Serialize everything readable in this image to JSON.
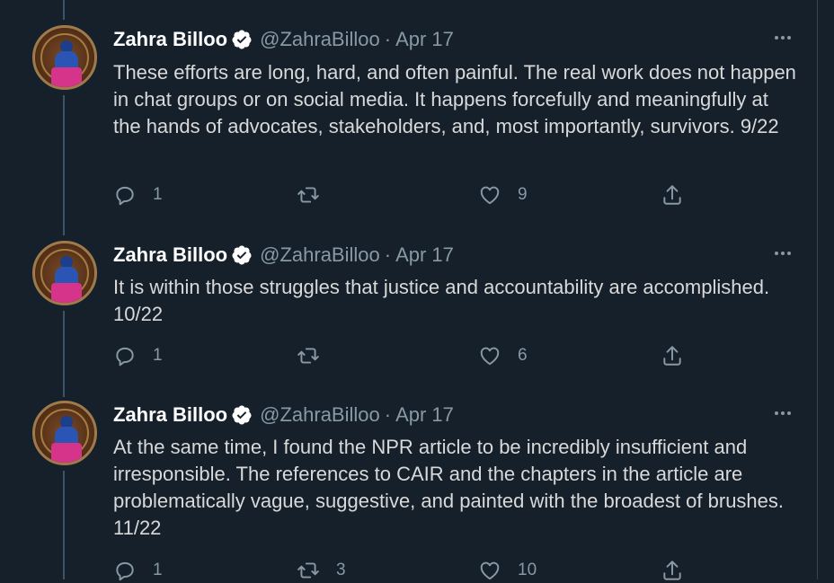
{
  "author": {
    "name": "Zahra Billoo",
    "handle": "@ZahraBilloo",
    "separator": "·"
  },
  "tweets": [
    {
      "date": "Apr 17",
      "text": "These efforts are long, hard, and often painful. The real work does not happen in chat groups or on social media. It happens forcefully and meaningfully at the hands of advocates, stakeholders, and, most importantly, survivors. 9/22",
      "replies": "1",
      "retweets": "",
      "likes": "9"
    },
    {
      "date": "Apr 17",
      "text": "It is within those struggles that justice and accountability are accomplished. 10/22",
      "replies": "1",
      "retweets": "",
      "likes": "6"
    },
    {
      "date": "Apr 17",
      "text": "At the same time, I found the NPR article to be incredibly insufficient and irresponsible. The references to CAIR and the chapters in the article are problematically vague, suggestive, and painted with the broadest of brushes. 11/22",
      "replies": "1",
      "retweets": "3",
      "likes": "10"
    }
  ],
  "colors": {
    "background": "#15202b",
    "text": "#d9d9d9",
    "muted": "#8899a6",
    "verified": "#ffffff"
  },
  "icons": [
    "verified-badge-icon",
    "more-icon",
    "reply-icon",
    "retweet-icon",
    "like-icon",
    "share-icon"
  ]
}
